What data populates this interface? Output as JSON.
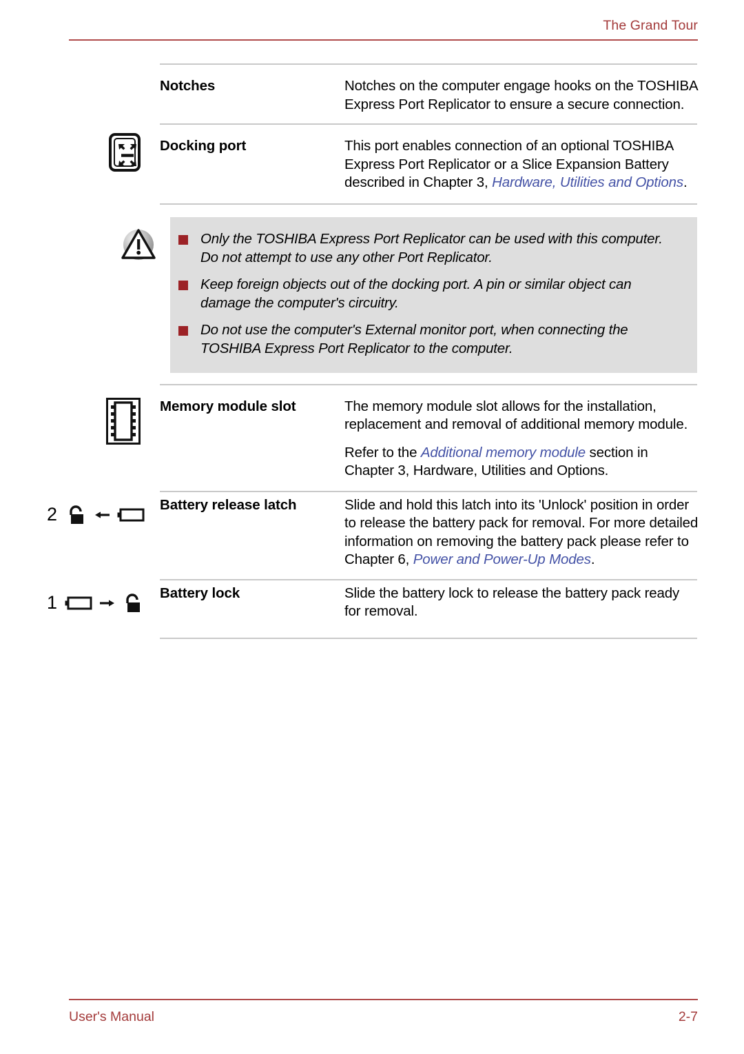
{
  "header": {
    "title": "The Grand Tour",
    "rule_color": "#B04A4A",
    "text_color": "#A33A3A"
  },
  "colors": {
    "link": "#4452A6",
    "warning_bg": "#DEDEDE",
    "bullet": "#9C2226",
    "divider": "#C9C9C9"
  },
  "rows": [
    {
      "icon": "none",
      "label": "Notches",
      "paragraphs": [
        {
          "parts": [
            {
              "t": "Notches on the computer engage hooks on the TOSHIBA Express Port Replicator to ensure a secure connection.",
              "style": "plain"
            }
          ]
        }
      ]
    },
    {
      "icon": "docking-port-icon",
      "label": "Docking port",
      "paragraphs": [
        {
          "parts": [
            {
              "t": "This port enables connection of an optional TOSHIBA Express Port Replicator or a Slice Expansion Battery described in Chapter 3, ",
              "style": "plain"
            },
            {
              "t": "Hardware, Utilities and Options",
              "style": "link"
            },
            {
              "t": ".",
              "style": "plain"
            }
          ]
        }
      ]
    },
    {
      "icon": "memory-module-icon",
      "label": "Memory module slot",
      "paragraphs": [
        {
          "parts": [
            {
              "t": "The memory module slot allows for the installation, replacement and removal of additional memory module.",
              "style": "plain"
            }
          ]
        },
        {
          "parts": [
            {
              "t": "Refer to the ",
              "style": "plain"
            },
            {
              "t": "Additional memory module",
              "style": "link"
            },
            {
              "t": " section in Chapter 3, Hardware, Utilities and Options.",
              "style": "plain"
            }
          ]
        }
      ]
    },
    {
      "icon": "unlock-arrow-battery-icon",
      "icon_number": "2",
      "label": "Battery release latch",
      "paragraphs": [
        {
          "parts": [
            {
              "t": "Slide and hold this latch into its 'Unlock' position in order to release the battery pack for removal. For more detailed information on removing the battery pack please refer to Chapter 6, ",
              "style": "plain"
            },
            {
              "t": "Power and Power-Up Modes",
              "style": "link"
            },
            {
              "t": ".",
              "style": "plain"
            }
          ]
        }
      ]
    },
    {
      "icon": "battery-arrow-unlock-icon",
      "icon_number": "1",
      "label": "Battery lock",
      "paragraphs": [
        {
          "parts": [
            {
              "t": "Slide the battery lock to release the battery pack ready for removal.",
              "style": "plain"
            }
          ]
        }
      ]
    }
  ],
  "warning": {
    "icon": "warning-triangle-icon",
    "items": [
      "Only the TOSHIBA Express Port Replicator can be used with this computer. Do not attempt to use any other Port Replicator.",
      "Keep foreign objects out of the docking port. A pin or similar object can damage the computer's circuitry.",
      "Do not use the computer's External monitor port, when connecting the TOSHIBA Express Port Replicator to the computer."
    ]
  },
  "footer": {
    "left": "User's Manual",
    "right": "2-7"
  }
}
